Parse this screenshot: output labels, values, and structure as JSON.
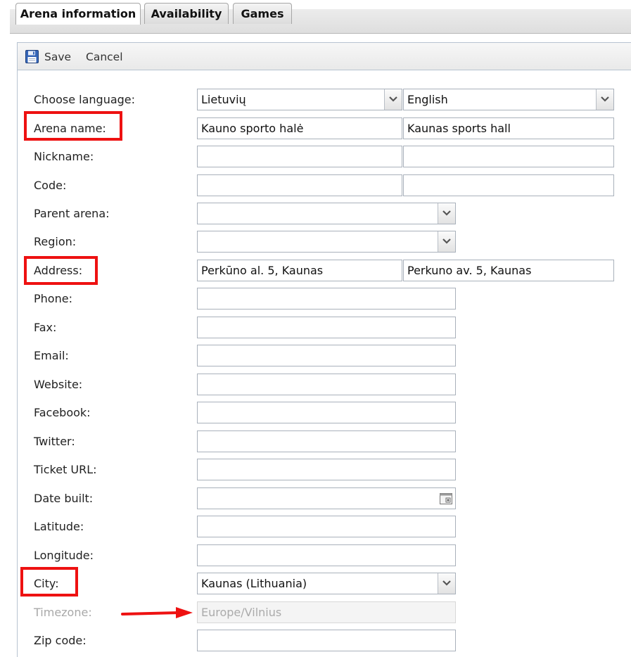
{
  "tabs": [
    {
      "label": "Arena information",
      "active": true
    },
    {
      "label": "Availability",
      "active": false
    },
    {
      "label": "Games",
      "active": false
    }
  ],
  "toolbar": {
    "save_label": "Save",
    "cancel_label": "Cancel",
    "save_icon": "floppy-disk-icon"
  },
  "form": {
    "choose_language": {
      "label": "Choose language:",
      "value1": "Lietuvių",
      "value2": "English"
    },
    "arena_name": {
      "label": "Arena name:",
      "value1": "Kauno sporto halė",
      "value2": "Kaunas sports hall"
    },
    "nickname": {
      "label": "Nickname:",
      "value1": "",
      "value2": ""
    },
    "code": {
      "label": "Code:",
      "value1": "",
      "value2": ""
    },
    "parent_arena": {
      "label": "Parent arena:",
      "value": ""
    },
    "region": {
      "label": "Region:",
      "value": ""
    },
    "address": {
      "label": "Address:",
      "value1": "Perkūno al. 5, Kaunas",
      "value2": "Perkuno av. 5, Kaunas"
    },
    "phone": {
      "label": "Phone:",
      "value": ""
    },
    "fax": {
      "label": "Fax:",
      "value": ""
    },
    "email": {
      "label": "Email:",
      "value": ""
    },
    "website": {
      "label": "Website:",
      "value": ""
    },
    "facebook": {
      "label": "Facebook:",
      "value": ""
    },
    "twitter": {
      "label": "Twitter:",
      "value": ""
    },
    "ticket_url": {
      "label": "Ticket URL:",
      "value": ""
    },
    "date_built": {
      "label": "Date built:",
      "value": ""
    },
    "latitude": {
      "label": "Latitude:",
      "value": ""
    },
    "longitude": {
      "label": "Longitude:",
      "value": ""
    },
    "city": {
      "label": "City:",
      "value": "Kaunas (Lithuania)"
    },
    "timezone": {
      "label": "Timezone:",
      "value": "Europe/Vilnius"
    },
    "zip_code": {
      "label": "Zip code:",
      "value": ""
    }
  },
  "annotations": {
    "highlight_color": "#ee1111"
  }
}
